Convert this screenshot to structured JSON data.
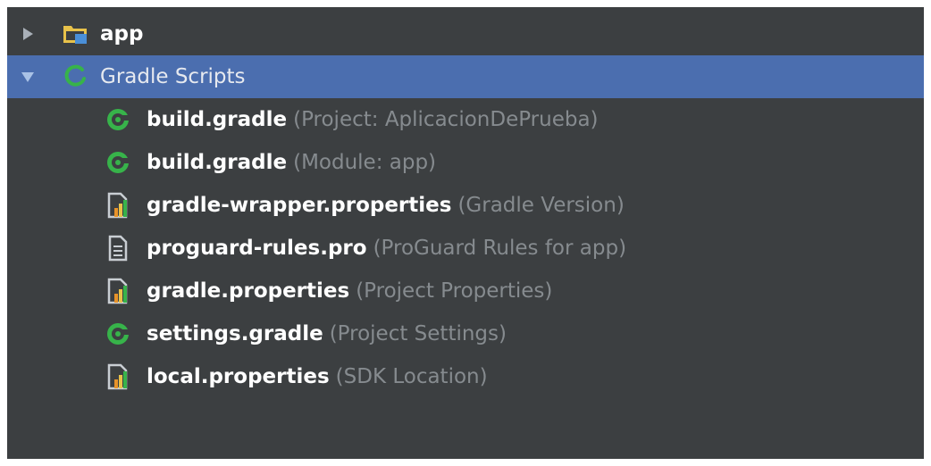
{
  "tree": {
    "app": {
      "name": "app",
      "icon": "module-folder-icon",
      "expanded": false
    },
    "gradle_scripts": {
      "name": "Gradle Scripts",
      "icon": "gradle-icon",
      "expanded": true,
      "selected": true
    },
    "children": [
      {
        "name": "build.gradle",
        "hint": "(Project: AplicacionDePrueba)",
        "icon": "gradle-file-icon"
      },
      {
        "name": "build.gradle",
        "hint": "(Module: app)",
        "icon": "gradle-file-icon"
      },
      {
        "name": "gradle-wrapper.properties",
        "hint": "(Gradle Version)",
        "icon": "properties-file-icon"
      },
      {
        "name": "proguard-rules.pro",
        "hint": "(ProGuard Rules for app)",
        "icon": "text-file-icon"
      },
      {
        "name": "gradle.properties",
        "hint": "(Project Properties)",
        "icon": "properties-file-icon"
      },
      {
        "name": "settings.gradle",
        "hint": "(Project Settings)",
        "icon": "gradle-file-icon"
      },
      {
        "name": "local.properties",
        "hint": "(SDK Location)",
        "icon": "properties-file-icon"
      }
    ]
  },
  "colors": {
    "background": "#3c3f41",
    "selection": "#4b6eaf",
    "text": "#ffffff",
    "hint": "#868b8f",
    "gradle_green": "#37b34a",
    "folder_yellow": "#e8c24a",
    "module_blue": "#4a8fd8"
  }
}
